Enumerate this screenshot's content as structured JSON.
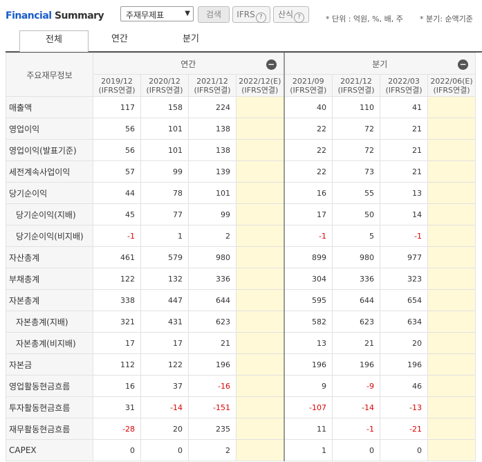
{
  "header": {
    "title_part1": "Financial",
    "title_part2": "Summary",
    "select_value": "주재무제표",
    "search_label": "검색",
    "ifrs_label": "IFRS",
    "formula_label": "산식",
    "unit_note": "* 단위 : 억원, %, 배, 주",
    "qtr_note": "* 분기: 순액기준"
  },
  "tabs": [
    "전체",
    "연간",
    "분기"
  ],
  "table": {
    "row_header": "주요재무정보",
    "annual_group": "연간",
    "quarter_group": "분기",
    "columns": [
      {
        "period": "2019/12",
        "basis": "(IFRS연결)"
      },
      {
        "period": "2020/12",
        "basis": "(IFRS연결)"
      },
      {
        "period": "2021/12",
        "basis": "(IFRS연결)"
      },
      {
        "period": "2022/12(E)",
        "basis": "(IFRS연결)"
      },
      {
        "period": "2021/09",
        "basis": "(IFRS연결)"
      },
      {
        "period": "2021/12",
        "basis": "(IFRS연결)"
      },
      {
        "period": "2022/03",
        "basis": "(IFRS연결)"
      },
      {
        "period": "2022/06(E)",
        "basis": "(IFRS연결)"
      }
    ],
    "rows": [
      {
        "label": "매출액",
        "sub": false,
        "values": [
          "117",
          "158",
          "224",
          "",
          "40",
          "110",
          "41",
          ""
        ]
      },
      {
        "label": "영업이익",
        "sub": false,
        "values": [
          "56",
          "101",
          "138",
          "",
          "22",
          "72",
          "21",
          ""
        ]
      },
      {
        "label": "영업이익(발표기준)",
        "sub": false,
        "values": [
          "56",
          "101",
          "138",
          "",
          "22",
          "72",
          "21",
          ""
        ]
      },
      {
        "label": "세전계속사업이익",
        "sub": false,
        "values": [
          "57",
          "99",
          "139",
          "",
          "22",
          "73",
          "21",
          ""
        ]
      },
      {
        "label": "당기순이익",
        "sub": false,
        "values": [
          "44",
          "78",
          "101",
          "",
          "16",
          "55",
          "13",
          ""
        ]
      },
      {
        "label": "당기순이익(지배)",
        "sub": true,
        "values": [
          "45",
          "77",
          "99",
          "",
          "17",
          "50",
          "14",
          ""
        ]
      },
      {
        "label": "당기순이익(비지배)",
        "sub": true,
        "values": [
          "-1",
          "1",
          "2",
          "",
          "-1",
          "5",
          "-1",
          ""
        ]
      },
      {
        "label": "자산총계",
        "sub": false,
        "values": [
          "461",
          "579",
          "980",
          "",
          "899",
          "980",
          "977",
          ""
        ]
      },
      {
        "label": "부채총계",
        "sub": false,
        "values": [
          "122",
          "132",
          "336",
          "",
          "304",
          "336",
          "323",
          ""
        ]
      },
      {
        "label": "자본총계",
        "sub": false,
        "values": [
          "338",
          "447",
          "644",
          "",
          "595",
          "644",
          "654",
          ""
        ]
      },
      {
        "label": "자본총계(지배)",
        "sub": true,
        "values": [
          "321",
          "431",
          "623",
          "",
          "582",
          "623",
          "634",
          ""
        ]
      },
      {
        "label": "자본총계(비지배)",
        "sub": true,
        "values": [
          "17",
          "17",
          "21",
          "",
          "13",
          "21",
          "20",
          ""
        ]
      },
      {
        "label": "자본금",
        "sub": false,
        "values": [
          "112",
          "122",
          "196",
          "",
          "196",
          "196",
          "196",
          ""
        ]
      },
      {
        "label": "영업활동현금흐름",
        "sub": false,
        "values": [
          "16",
          "37",
          "-16",
          "",
          "9",
          "-9",
          "46",
          ""
        ]
      },
      {
        "label": "투자활동현금흐름",
        "sub": false,
        "values": [
          "31",
          "-14",
          "-151",
          "",
          "-107",
          "-14",
          "-13",
          ""
        ]
      },
      {
        "label": "재무활동현금흐름",
        "sub": false,
        "values": [
          "-28",
          "20",
          "235",
          "",
          "11",
          "-1",
          "-21",
          ""
        ]
      },
      {
        "label": "CAPEX",
        "sub": false,
        "values": [
          "0",
          "0",
          "2",
          "",
          "1",
          "0",
          "0",
          ""
        ]
      }
    ]
  },
  "colors": {
    "title_accent": "#1a5cc8",
    "estimate_bg": "#fff9d7",
    "negative": "#d00000",
    "header_bg": "#f6f6f6"
  }
}
